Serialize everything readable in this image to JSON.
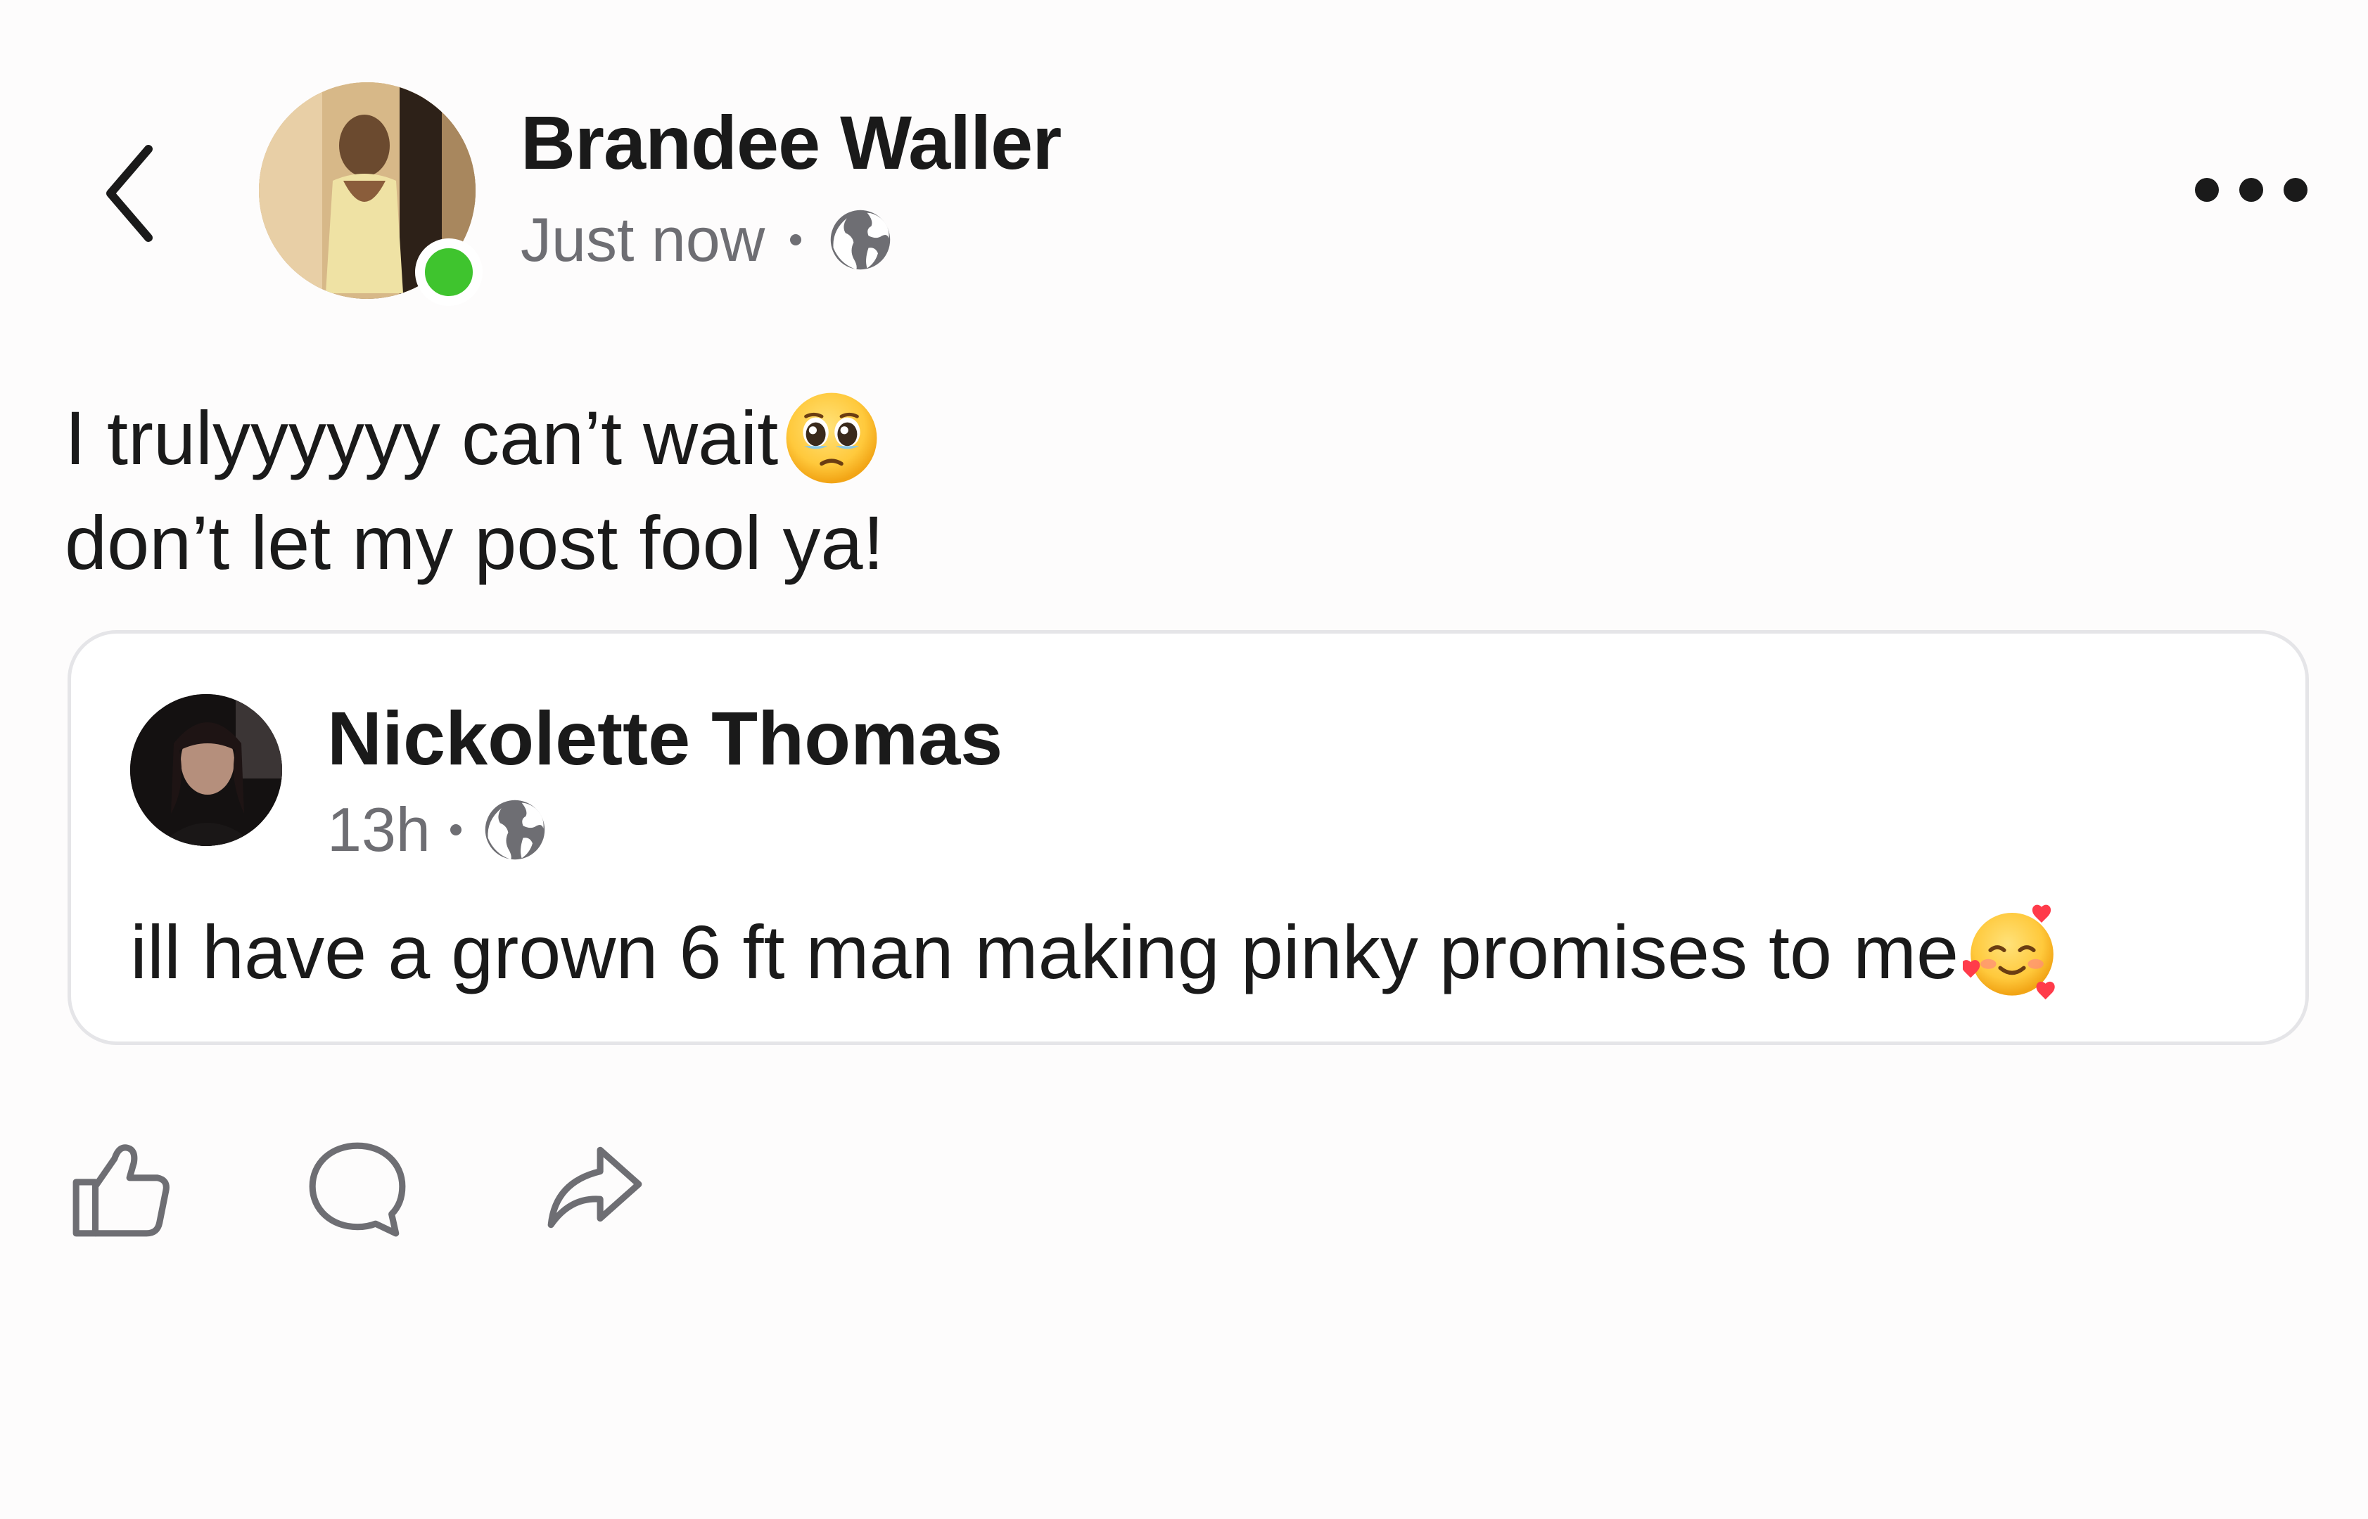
{
  "post": {
    "author_name": "Brandee Waller",
    "timestamp": "Just now",
    "audience_icon": "globe-icon",
    "online": true,
    "text_line1": "I trulyyyyyy can’t wait",
    "text_line1_emoji": "face-holding-back-tears",
    "text_line2": "don’t let my post fool ya!"
  },
  "shared_post": {
    "author_name": "Nickolette Thomas",
    "timestamp": "13h",
    "audience_icon": "globe-icon",
    "text": "ill have a grown 6 ft man making pinky promises to me",
    "text_emoji": "smiling-face-with-hearts"
  },
  "header": {
    "back_icon": "chevron-left-icon",
    "more_icon": "more-horizontal-icon"
  },
  "actions": [
    {
      "name": "like",
      "icon": "thumbs-up-icon"
    },
    {
      "name": "comment",
      "icon": "comment-icon"
    },
    {
      "name": "share",
      "icon": "share-icon"
    }
  ],
  "colors": {
    "online_dot": "#3fc42e",
    "secondary_text": "#6e6e73",
    "card_border": "#e5e5e8"
  }
}
